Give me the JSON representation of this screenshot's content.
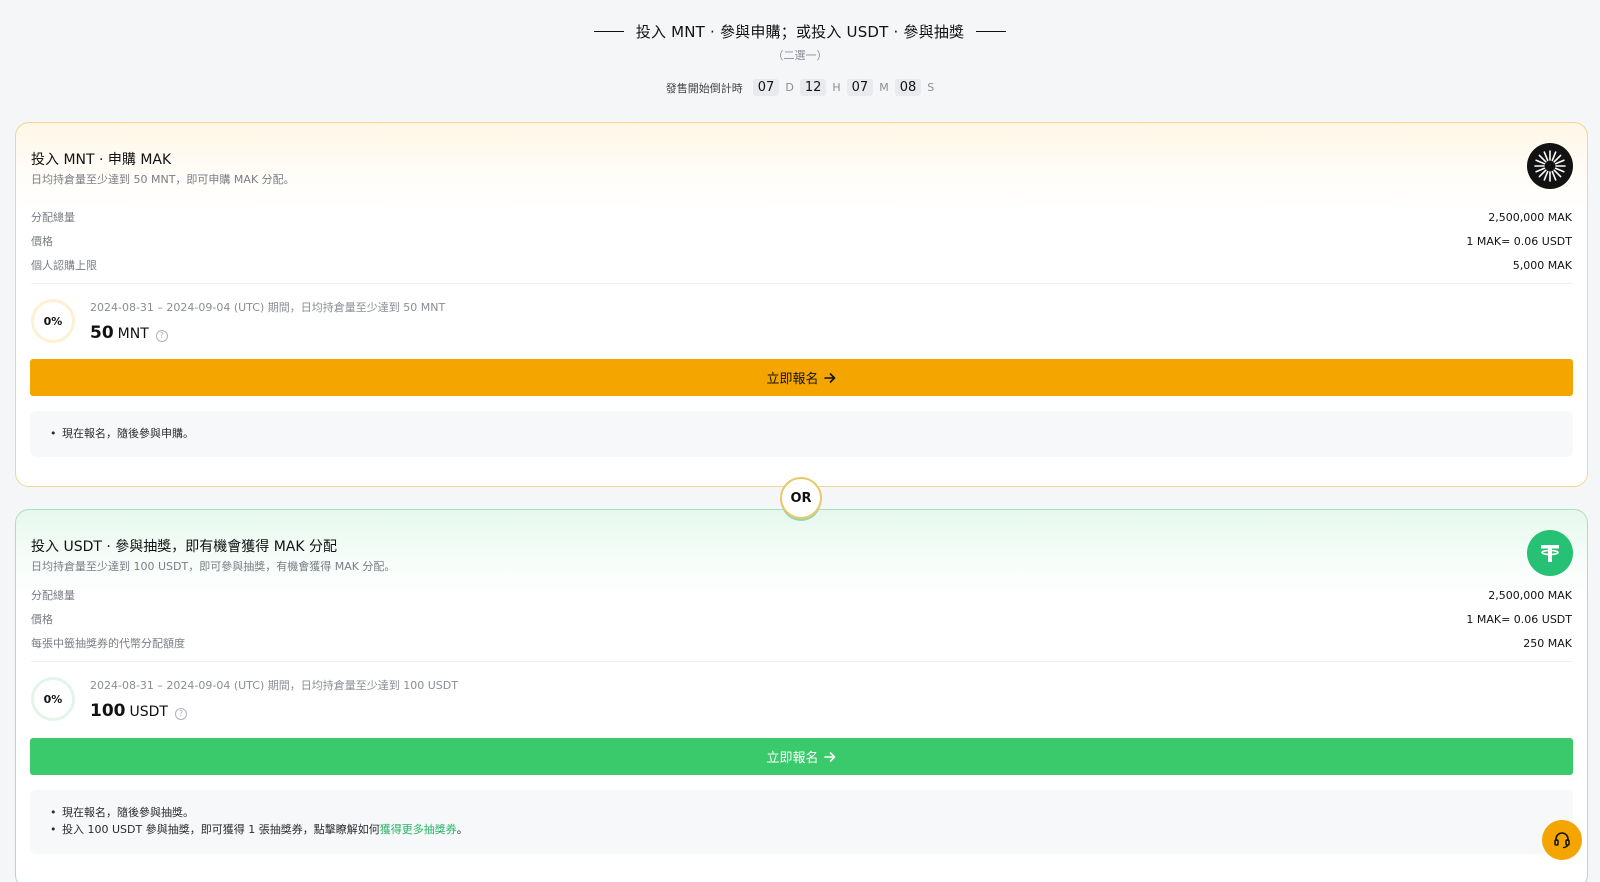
{
  "header": {
    "headline": "投入 MNT · 參與申購；或投入 USDT · 參與抽獎",
    "subline": "（二選一）",
    "countdown_label": "發售開始倒計時",
    "days": "07",
    "days_unit": "D",
    "hours": "12",
    "hours_unit": "H",
    "minutes": "07",
    "minutes_unit": "M",
    "seconds": "08",
    "seconds_unit": "S"
  },
  "mnt_card": {
    "title": "投入 MNT · 申購 MAK",
    "description": "日均持倉量至少達到 50 MNT，即可申購 MAK 分配。",
    "logo_icon": "mak-token-icon",
    "rows": [
      {
        "label": "分配總量",
        "value": "2,500,000 MAK"
      },
      {
        "label": "價格",
        "value": "1 MAK= 0.06 USDT"
      },
      {
        "label": "個人認購上限",
        "value": "5,000 MAK"
      }
    ],
    "progress": "0%",
    "progress_fraction": 0,
    "period": "2024-08-31 – 2024-09-04 (UTC) 期間，日均持倉量至少達到 50 MNT",
    "amount": "50",
    "currency": "MNT",
    "cta_label": "立即報名",
    "notes": [
      "現在報名，隨後參與申購。"
    ],
    "accent": "#f5a500"
  },
  "or_label": "OR",
  "usdt_card": {
    "title": "投入 USDT · 參與抽獎，即有機會獲得 MAK 分配",
    "description": "日均持倉量至少達到 100 USDT，即可參與抽獎，有機會獲得 MAK 分配。",
    "logo_icon": "usdt-tether-icon",
    "rows": [
      {
        "label": "分配總量",
        "value": "2,500,000 MAK"
      },
      {
        "label": "價格",
        "value": "1 MAK= 0.06 USDT"
      },
      {
        "label": "每張中籤抽獎券的代幣分配額度",
        "value": "250 MAK"
      }
    ],
    "progress": "0%",
    "progress_fraction": 0,
    "period": "2024-08-31 – 2024-09-04 (UTC) 期間，日均持倉量至少達到 100 USDT",
    "amount": "100",
    "currency": "USDT",
    "cta_label": "立即報名",
    "note_1": "現在報名，隨後參與抽獎。",
    "note_2_prefix": "投入 100 USDT 參與抽獎，即可獲得 1 張抽獎券，點擊瞭解如何",
    "note_2_link": "獲得更多抽獎券",
    "note_2_suffix": "。",
    "accent": "#3ac96b"
  },
  "support_icon": "headset-support-icon"
}
